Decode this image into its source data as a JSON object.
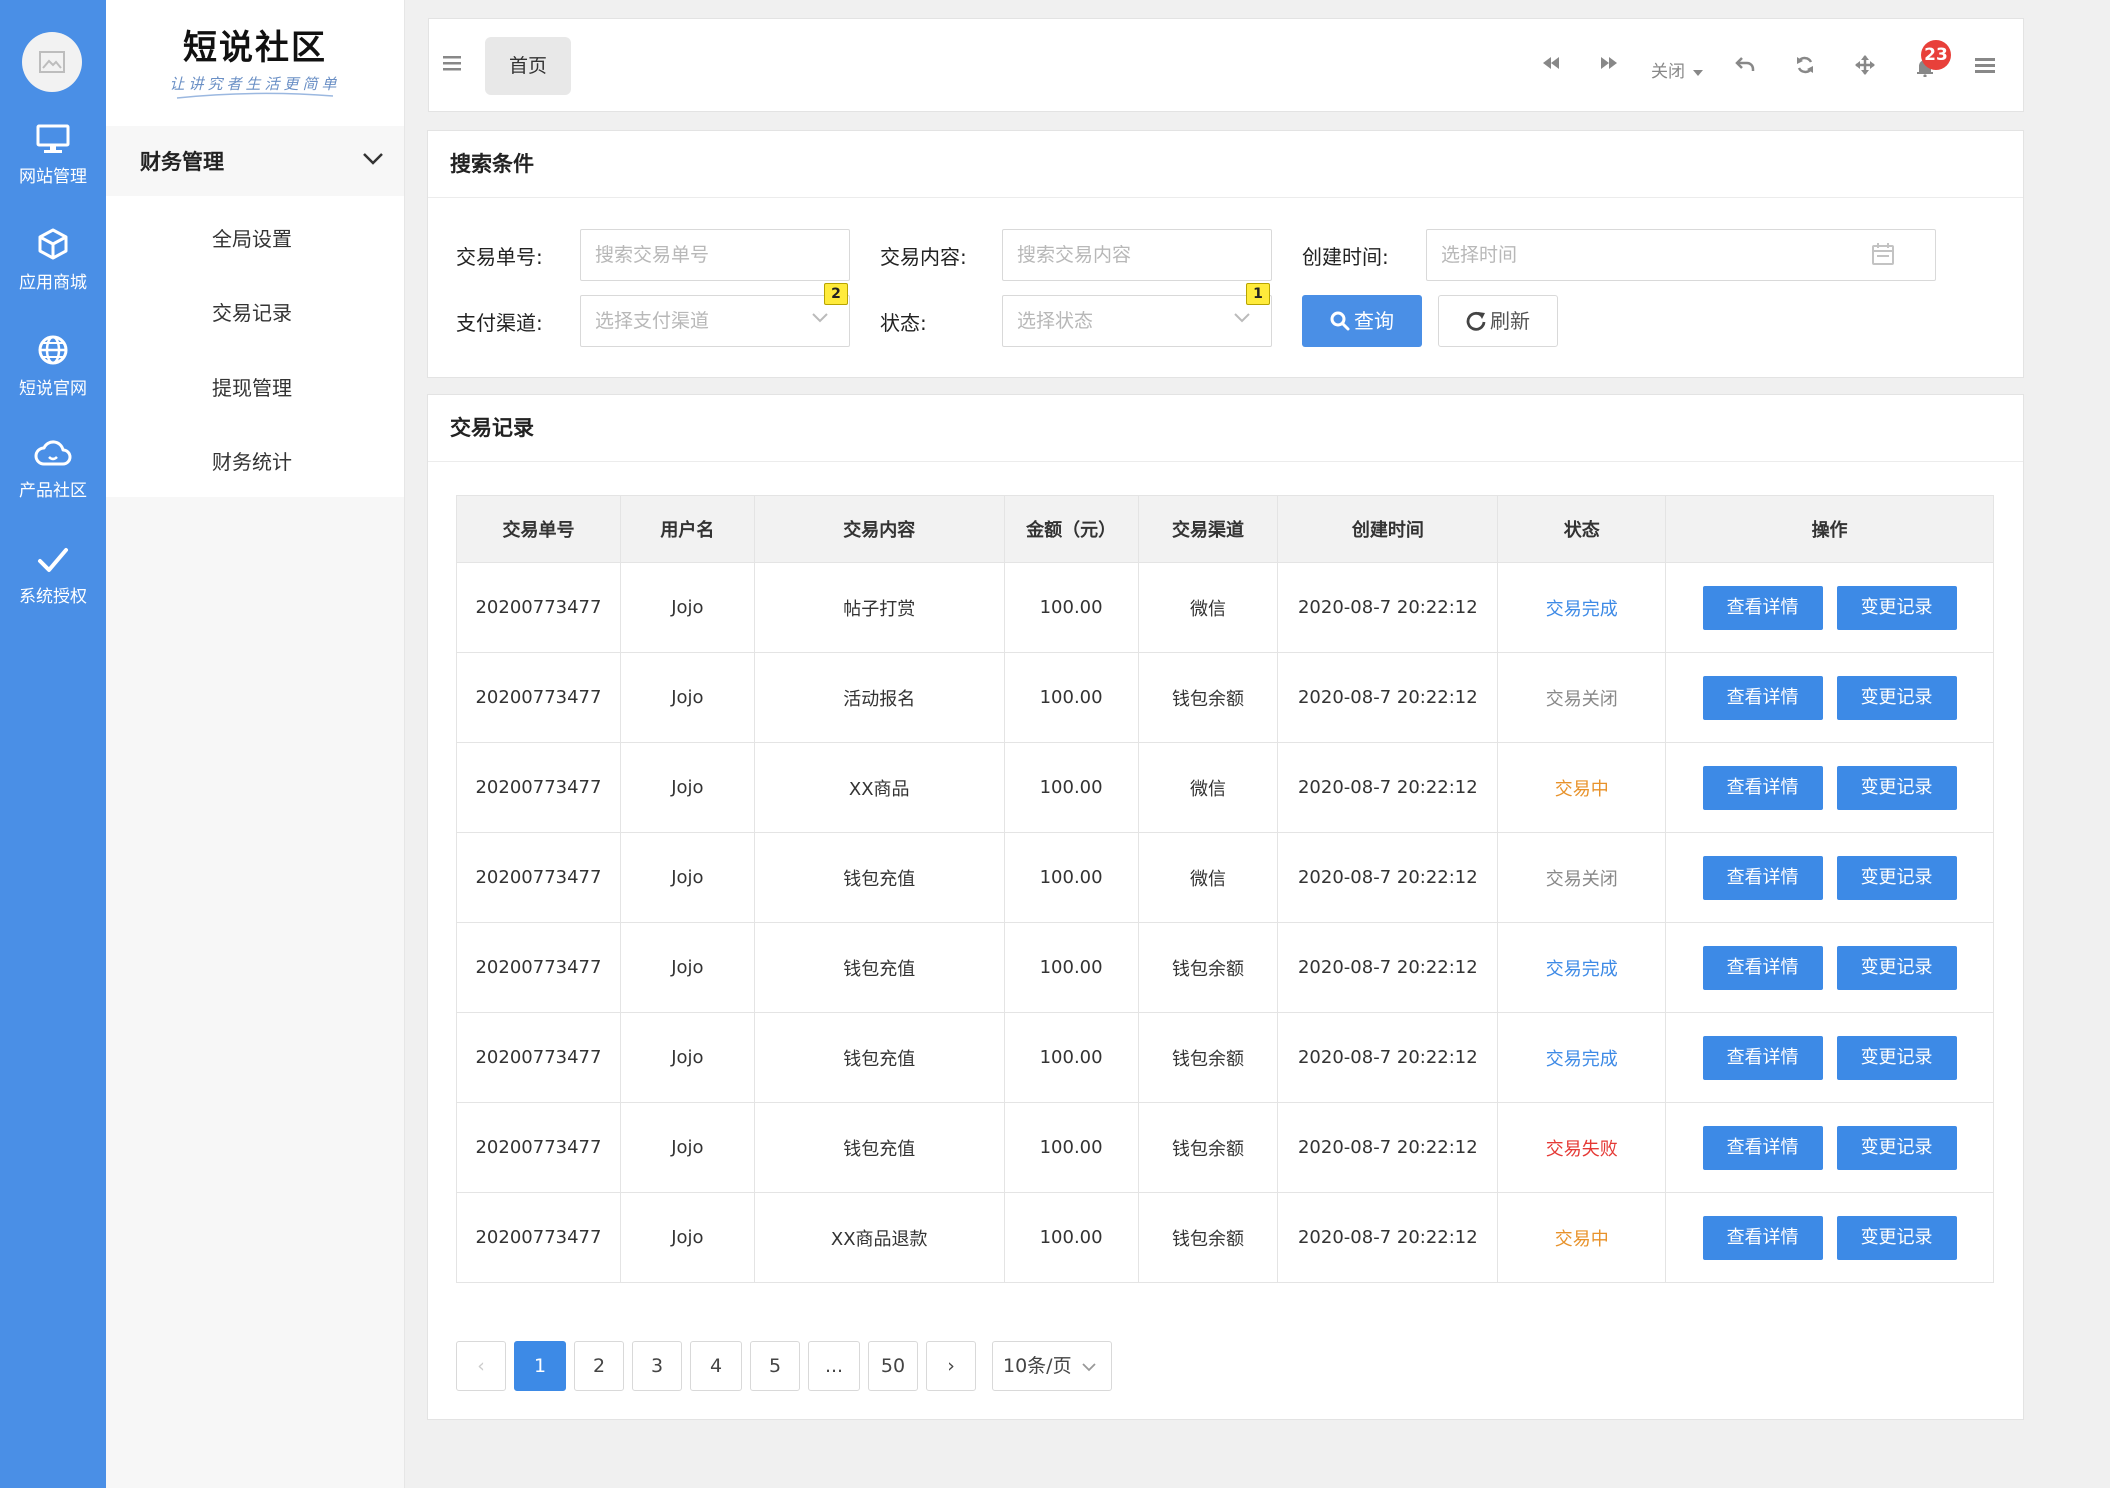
{
  "rail": {
    "items": [
      {
        "label": "网站管理",
        "icon": "monitor-icon"
      },
      {
        "label": "应用商城",
        "icon": "box-icon"
      },
      {
        "label": "短说官网",
        "icon": "globe-icon"
      },
      {
        "label": "产品社区",
        "icon": "cloud-icon"
      },
      {
        "label": "系统授权",
        "icon": "check-icon"
      }
    ]
  },
  "brand": {
    "name": "短说社区",
    "slogan": "让讲究者生活更简单"
  },
  "submenu": {
    "group": "财务管理",
    "items": [
      "全局设置",
      "交易记录",
      "提现管理",
      "财务统计"
    ]
  },
  "topbar": {
    "home_tab": "首页",
    "close_label": "关闭",
    "notification_count": "23"
  },
  "search": {
    "title": "搜索条件",
    "order_label": "交易单号:",
    "order_placeholder": "搜索交易单号",
    "content_label": "交易内容:",
    "content_placeholder": "搜索交易内容",
    "time_label": "创建时间:",
    "time_placeholder": "选择时间",
    "channel_label": "支付渠道:",
    "channel_placeholder": "选择支付渠道",
    "channel_count": "2",
    "status_label": "状态:",
    "status_placeholder": "选择状态",
    "status_count": "1",
    "query_btn": "查询",
    "refresh_btn": "刷新"
  },
  "records": {
    "title": "交易记录",
    "columns": [
      "交易单号",
      "用户名",
      "交易内容",
      "金额（元）",
      "交易渠道",
      "创建时间",
      "状态",
      "操作"
    ],
    "detail_btn": "查看详情",
    "change_btn": "变更记录",
    "rows": [
      {
        "id": "20200773477",
        "user": "Jojo",
        "content": "帖子打赏",
        "amount": "100.00",
        "channel": "微信",
        "time": "2020-08-7 20:22:12",
        "status": "交易完成",
        "status_color": "#3d8ae6"
      },
      {
        "id": "20200773477",
        "user": "Jojo",
        "content": "活动报名",
        "amount": "100.00",
        "channel": "钱包余额",
        "time": "2020-08-7 20:22:12",
        "status": "交易关闭",
        "status_color": "#888888"
      },
      {
        "id": "20200773477",
        "user": "Jojo",
        "content": "XX商品",
        "amount": "100.00",
        "channel": "微信",
        "time": "2020-08-7 20:22:12",
        "status": "交易中",
        "status_color": "#e8922a"
      },
      {
        "id": "20200773477",
        "user": "Jojo",
        "content": "钱包充值",
        "amount": "100.00",
        "channel": "微信",
        "time": "2020-08-7 20:22:12",
        "status": "交易关闭",
        "status_color": "#888888"
      },
      {
        "id": "20200773477",
        "user": "Jojo",
        "content": "钱包充值",
        "amount": "100.00",
        "channel": "钱包余额",
        "time": "2020-08-7 20:22:12",
        "status": "交易完成",
        "status_color": "#3d8ae6"
      },
      {
        "id": "20200773477",
        "user": "Jojo",
        "content": "钱包充值",
        "amount": "100.00",
        "channel": "钱包余额",
        "time": "2020-08-7 20:22:12",
        "status": "交易完成",
        "status_color": "#3d8ae6"
      },
      {
        "id": "20200773477",
        "user": "Jojo",
        "content": "钱包充值",
        "amount": "100.00",
        "channel": "钱包余额",
        "time": "2020-08-7 20:22:12",
        "status": "交易失败",
        "status_color": "#e53935"
      },
      {
        "id": "20200773477",
        "user": "Jojo",
        "content": "XX商品退款",
        "amount": "100.00",
        "channel": "钱包余额",
        "time": "2020-08-7 20:22:12",
        "status": "交易中",
        "status_color": "#e8922a"
      }
    ]
  },
  "pagination": {
    "prev": "‹",
    "pages": [
      "1",
      "2",
      "3",
      "4",
      "5",
      "...",
      "50"
    ],
    "current": "1",
    "next": "›",
    "page_size": "10条/页"
  },
  "colors": {
    "accent": "#4a8fe6",
    "rail": "#4a8fe6",
    "badge": "#e8403a"
  }
}
